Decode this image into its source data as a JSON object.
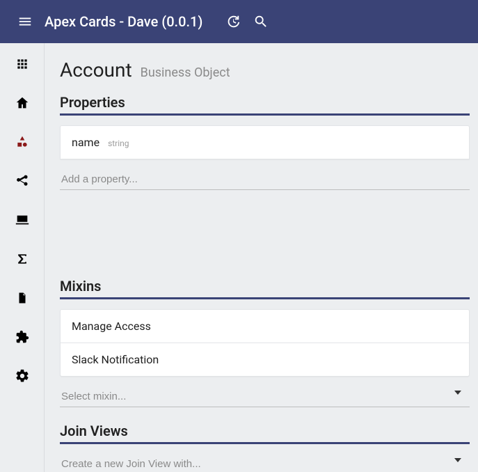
{
  "appbar": {
    "title": "Apex Cards - Dave (0.0.1)"
  },
  "page": {
    "object_name": "Account",
    "object_type": "Business Object"
  },
  "properties": {
    "title": "Properties",
    "items": [
      {
        "name": "name",
        "type": "string"
      }
    ],
    "add_placeholder": "Add a property..."
  },
  "mixins": {
    "title": "Mixins",
    "items": [
      {
        "label": "Manage Access"
      },
      {
        "label": "Slack Notification"
      }
    ],
    "select_placeholder": "Select mixin..."
  },
  "joinviews": {
    "title": "Join Views",
    "create_placeholder": "Create a new Join View with..."
  }
}
